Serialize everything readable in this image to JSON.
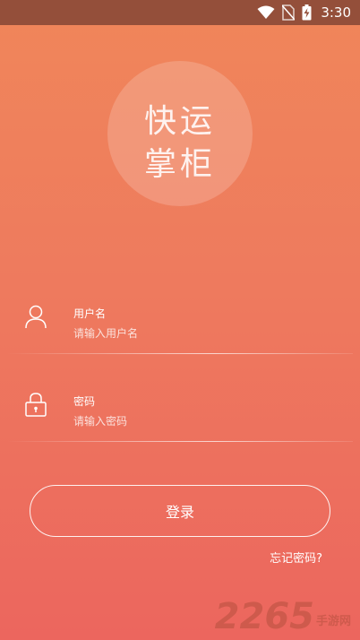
{
  "status_bar": {
    "time": "3:30",
    "icons": [
      "wifi-icon",
      "no-sim-icon",
      "battery-charging-icon"
    ]
  },
  "logo": {
    "line1": "快运",
    "line2": "掌柜"
  },
  "username_field": {
    "label": "用户名",
    "placeholder": "请输入用户名",
    "value": "",
    "icon": "user-icon"
  },
  "password_field": {
    "label": "密码",
    "placeholder": "请输入密码",
    "value": "",
    "icon": "lock-icon"
  },
  "login_button": {
    "label": "登录"
  },
  "forgot_password": {
    "label": "忘记密码?"
  },
  "watermark": {
    "number": "2265",
    "text": "手游网"
  },
  "colors": {
    "status_bar": "#944f3a",
    "gradient_top": "#f0865a",
    "gradient_bottom": "#ec665e"
  }
}
